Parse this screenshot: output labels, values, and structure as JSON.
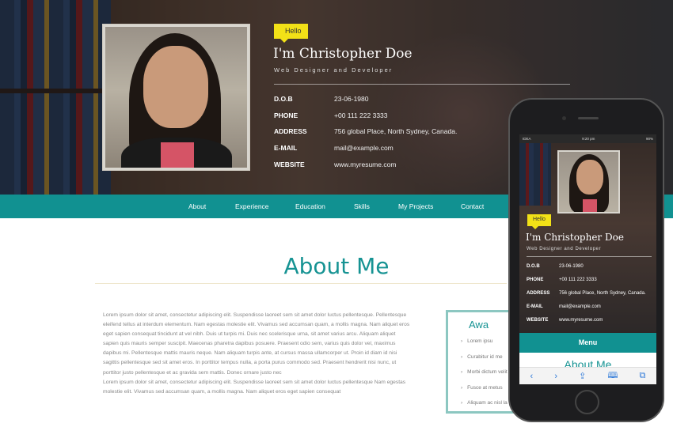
{
  "hero": {
    "hello": "Hello",
    "name": "I'm Christopher Doe",
    "role": "Web Designer and Developer",
    "info": [
      {
        "key": "D.O.B",
        "value": "23-06-1980"
      },
      {
        "key": "PHONE",
        "value": "+00 111 222 3333"
      },
      {
        "key": "ADDRESS",
        "value": "756 global Place, North Sydney, Canada."
      },
      {
        "key": "E-MAIL",
        "value": "mail@example.com"
      },
      {
        "key": "WEBSITE",
        "value": "www.myresume.com"
      }
    ]
  },
  "nav": {
    "items": [
      "About",
      "Experience",
      "Education",
      "Skills",
      "My Projects",
      "Contact"
    ]
  },
  "about": {
    "title": "About Me",
    "text": "Lorem ipsum dolor sit amet, consectetur adipiscing elit. Suspendisse laoreet sem sit amet dolor luctus pellentesque. Pellentesque eleifend tellus at interdum elementum. Nam egestas molestie elit. Vivamus sed accumsan quam, a mollis magna. Nam aliquet eros eget sapien consequat tincidunt at vel nibh. Duis ut turpis mi. Duis nec scelerisque urna, sit amet varius arcu. Aliquam aliquet sapien quis mauris semper suscipit. Maecenas pharetra dapibus posuere. Praesent odio sem, varius quis dolor vel, maximus dapibus mi. Pellentesque mattis mauris neque. Nam aliquam turpis ante, at cursus massa ullamcorper ut. Proin id diam id nisi sagittis pellentesque sed sit amet eros. In porttitor tempus nulla, a porta purus commodo sed. Praesent hendrerit nisi nunc, ut porttitor justo pellentesque et ac gravida sem mattis. Donec ornare justo nec",
    "text2": "Lorem ipsum dolor sit amet, consectetur adipiscing elit. Suspendisse laoreet sem sit amet dolor luctus pellentesque Nam egestas molestie elit. Vivamus sed accumsan quam, a mollis magna. Nam aliquet eros eget sapien consequat"
  },
  "award": {
    "title": "Awa",
    "items": [
      "Lorem ipsu",
      "Curabitur id me",
      "Morbi dictum velit",
      "Fusce at metus",
      "Aliquam ac nisl la"
    ]
  },
  "phone": {
    "status_left": "IDEA",
    "status_time": "9:20 pm",
    "status_battery": "90%",
    "hello": "Hello",
    "name": "I'm Christopher Doe",
    "role": "Web Designer and Developer",
    "info": [
      {
        "key": "D.O.B",
        "value": "23-06-1980"
      },
      {
        "key": "PHONE",
        "value": "+00 111 222 3333"
      },
      {
        "key": "ADDRESS",
        "value": "756 global Place, North Sydney, Canada."
      },
      {
        "key": "E-MAIL",
        "value": "mail@example.com"
      },
      {
        "key": "WEBSITE",
        "value": "www.myresume.com"
      }
    ],
    "menu": "Menu",
    "about_title": "About Me",
    "toolbar_icons": [
      "back-icon",
      "forward-icon",
      "share-icon",
      "bookmarks-icon",
      "tabs-icon"
    ]
  },
  "colors": {
    "teal": "#119191",
    "yellow": "#f2e117",
    "award_border": "#8cc7c1"
  }
}
